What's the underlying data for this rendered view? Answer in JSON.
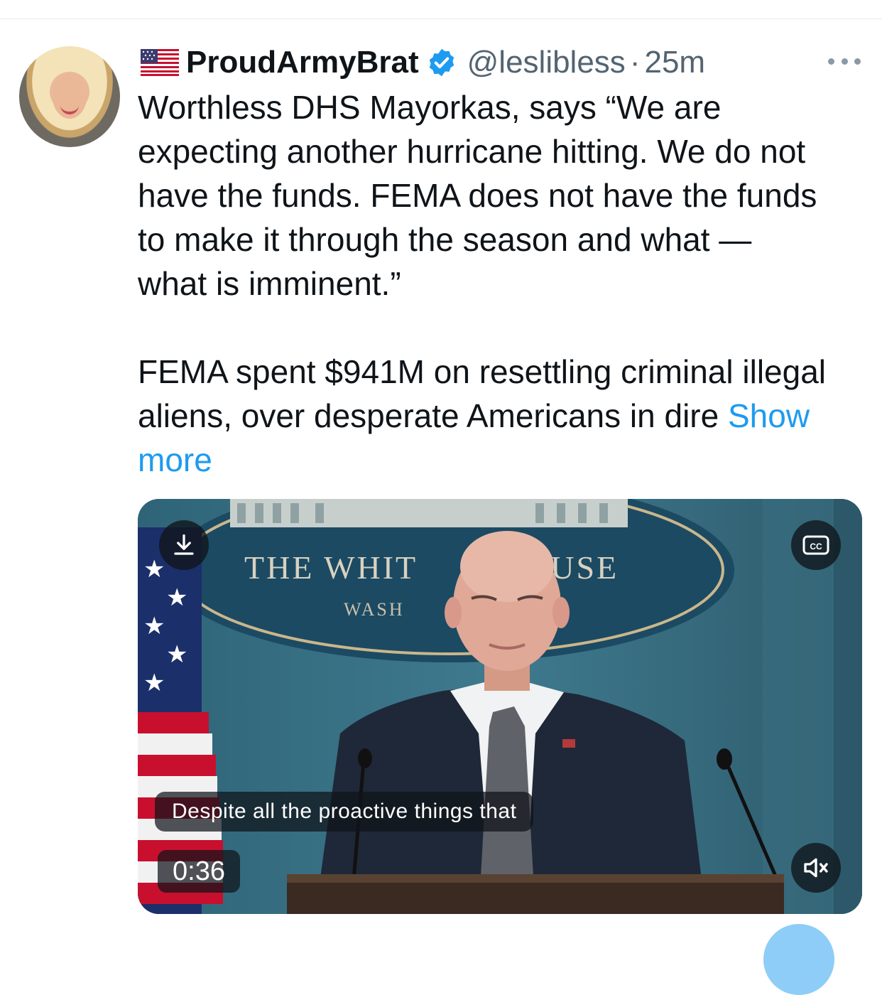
{
  "tweet": {
    "author": {
      "display_name": "ProudArmyBrat",
      "handle": "@leslibless",
      "verified": true,
      "flag_icon": "us-flag-icon"
    },
    "separator": "·",
    "time_ago": "25m",
    "text": "Worthless DHS Mayorkas, says “We are\nexpecting another hurricane hitting. We do not\nhave the funds. FEMA does not have the funds\nto make it through the season and what —\nwhat is imminent.”\n\nFEMA spent $941M on resettling criminal illegal\naliens, over desperate Americans in dire ",
    "show_more_label": "Show\nmore",
    "more_icon": "ellipsis-icon"
  },
  "video": {
    "caption": "Despite all the proactive things that",
    "duration": "0:36",
    "background_sign_line1": "THE WHIT",
    "background_sign_line1b": "OUSE",
    "background_sign_line2": "WASH",
    "cc_label": "CC",
    "download_icon": "download-icon",
    "mute_icon": "muted-speaker-icon"
  },
  "colors": {
    "link": "#1d9bf0",
    "text": "#0f1419",
    "secondary": "#536471",
    "verified": "#1d9bf0"
  }
}
